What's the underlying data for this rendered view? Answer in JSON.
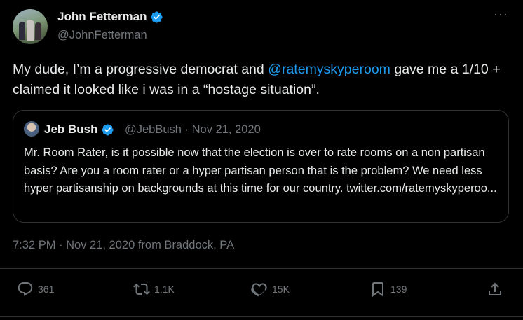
{
  "author": {
    "name": "John Fetterman",
    "handle": "@JohnFetterman"
  },
  "tweet": {
    "text_before": "My dude, I’m a progressive democrat and ",
    "mention": "@ratemyskyperoom",
    "text_after": " gave me a 1/10 + claimed it looked like i was in a “hostage situation”."
  },
  "quote": {
    "name": "Jeb Bush",
    "meta": "@JebBush · Nov 21, 2020",
    "text": "Mr. Room Rater, is it possible now that the election is over to rate rooms on a non partisan basis? Are you a room rater or a hyper partisan person that is the problem? We need less hyper partisanship on backgrounds at this time for our country. twitter.com/ratemyskyperoo..."
  },
  "timestamp": "7:32 PM · Nov 21, 2020 from Braddock, PA",
  "actions": {
    "replies": "361",
    "retweets": "1.1K",
    "likes": "15K",
    "bookmarks": "139"
  },
  "colors": {
    "accent": "#1d9bf0",
    "muted": "#71767b",
    "text": "#e7e9ea",
    "background": "#000000"
  }
}
